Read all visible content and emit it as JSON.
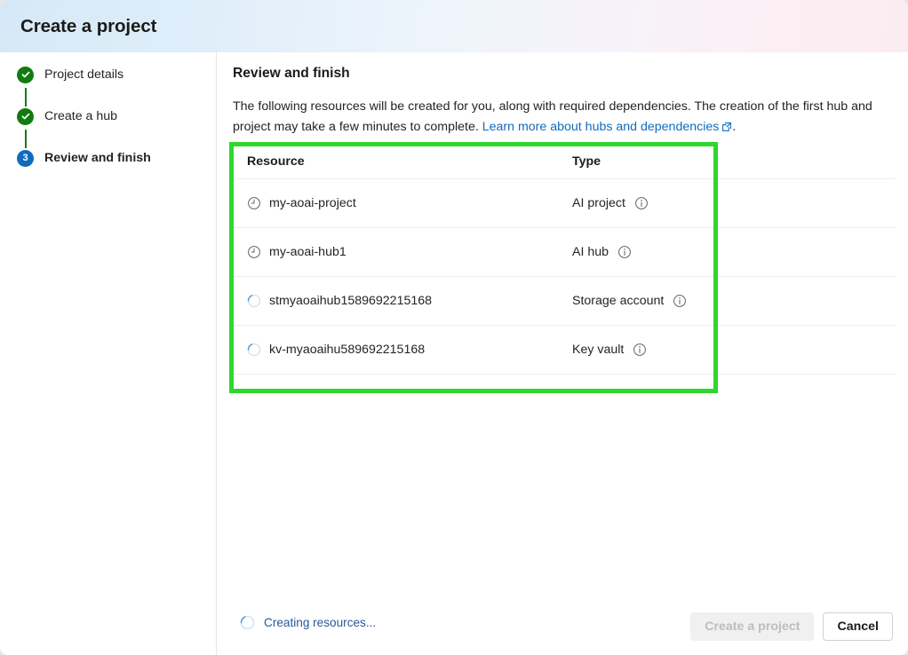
{
  "header": {
    "title": "Create a project"
  },
  "sidebar": {
    "steps": [
      {
        "label": "Project details",
        "state": "done",
        "badge": "check"
      },
      {
        "label": "Create a hub",
        "state": "done",
        "badge": "check"
      },
      {
        "label": "Review and finish",
        "state": "active",
        "badge": "3"
      }
    ]
  },
  "main": {
    "section_title": "Review and finish",
    "intro_part1": "The following resources will be created for you, along with required dependencies. The creation of the first hub and project may take a few minutes to complete. ",
    "intro_link": "Learn more about hubs and dependencies",
    "intro_part2": ".",
    "table": {
      "columns": [
        "Resource",
        "Type"
      ],
      "rows": [
        {
          "resource": "my-aoai-project",
          "type": "AI project",
          "status_icon": "clock-icon"
        },
        {
          "resource": "my-aoai-hub1",
          "type": "AI hub",
          "status_icon": "clock-icon"
        },
        {
          "resource": "stmyaoaihub1589692215168",
          "type": "Storage account",
          "status_icon": "spinner-icon"
        },
        {
          "resource": "kv-myaoaihu589692215168",
          "type": "Key vault",
          "status_icon": "spinner-icon"
        }
      ]
    }
  },
  "footer": {
    "progress_text": "Creating resources...",
    "create_button": "Create a project",
    "cancel_button": "Cancel"
  },
  "colors": {
    "accent_blue": "#0f6cbd",
    "success_green": "#107c10",
    "highlight_green": "#2fd62f",
    "progress_blue": "#2b579a"
  }
}
